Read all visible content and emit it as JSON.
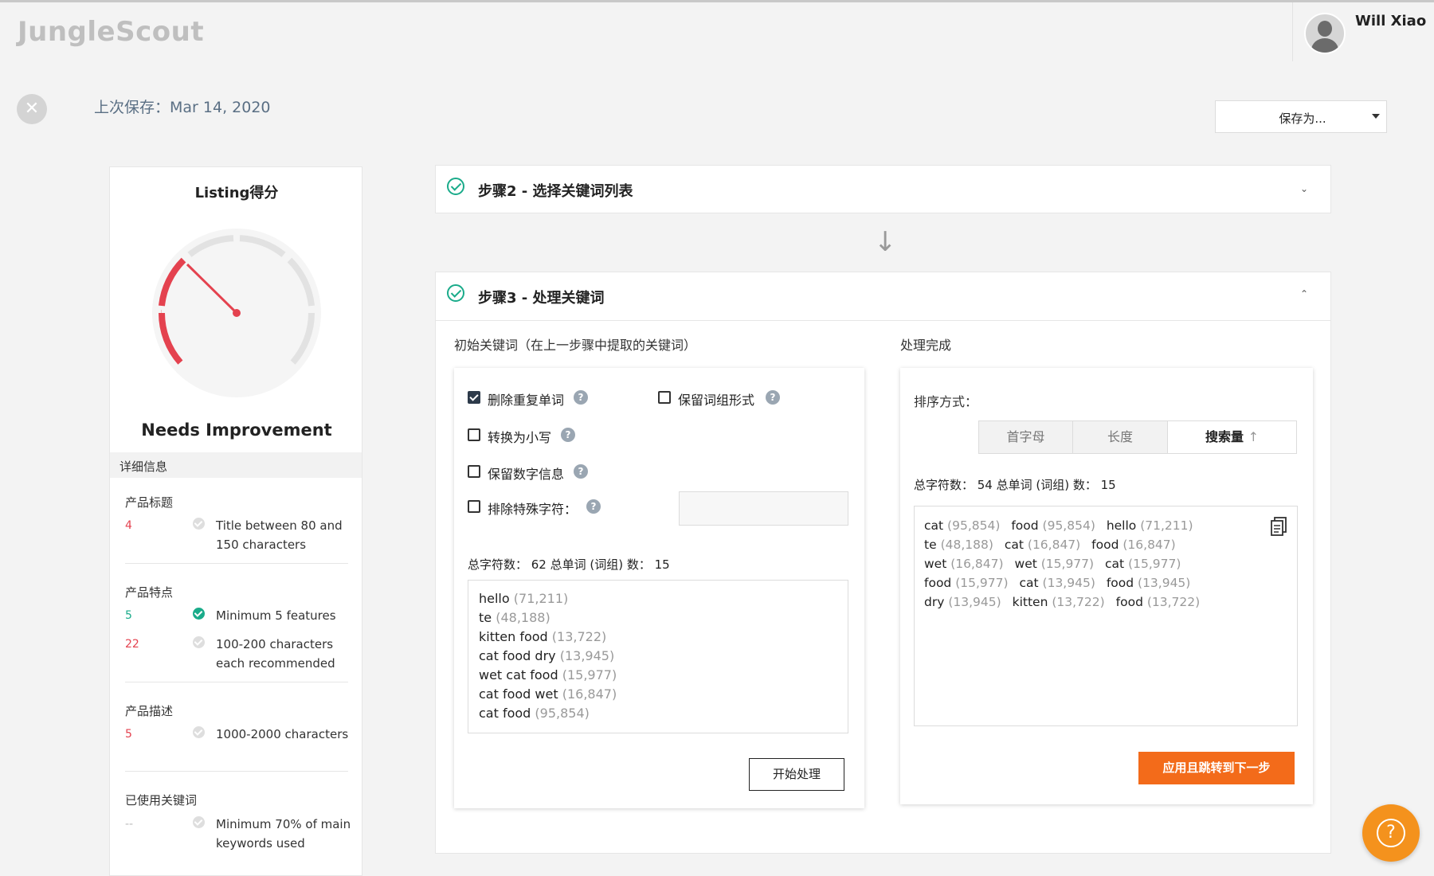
{
  "brand": {
    "logo": "JungleScout"
  },
  "user": {
    "name": "Will Xiao"
  },
  "header": {
    "last_saved": "上次保存：Mar 14, 2020",
    "save_as_label": "保存为..."
  },
  "score_panel": {
    "title": "Listing得分",
    "status": "Needs Improvement",
    "details_label": "详细信息",
    "sections": {
      "title": {
        "label": "产品标题",
        "value": "4",
        "req": "Title between 80 and 150 characters"
      },
      "features": {
        "label": "产品特点",
        "value1": "5",
        "req1": "Minimum 5 features",
        "value2": "22",
        "req2": "100-200 characters each recommended"
      },
      "description": {
        "label": "产品描述",
        "value": "5",
        "req": "1000-2000 characters"
      },
      "keywords": {
        "label": "已使用关键词",
        "value": "--",
        "req": "Minimum 70% of main keywords used"
      }
    }
  },
  "step2": {
    "title": "步骤2 - 选择关键词列表"
  },
  "step3": {
    "title": "步骤3 - 处理关键词",
    "left_title": "初始关键词（在上一步骤中提取的关键词）",
    "right_title": "处理完成",
    "options": {
      "remove_dupes": "删除重复单词",
      "keep_phrase": "保留词组形式",
      "lowercase": "转换为小写",
      "keep_numbers": "保留数字信息",
      "exclude_special": "排除特殊字符："
    },
    "left_stats": "总字符数： 62 总单词 (词组) 数： 15",
    "initial_keywords": [
      {
        "kw": "hello",
        "count": "(71,211)"
      },
      {
        "kw": "te",
        "count": "(48,188)"
      },
      {
        "kw": "kitten food",
        "count": "(13,722)"
      },
      {
        "kw": "cat food dry",
        "count": "(13,945)"
      },
      {
        "kw": "wet cat food",
        "count": "(15,977)"
      },
      {
        "kw": "cat food wet",
        "count": "(16,847)"
      },
      {
        "kw": "cat food",
        "count": "(95,854)"
      }
    ],
    "start_button": "开始处理",
    "sort_label": "排序方式：",
    "sort": {
      "alpha": "首字母",
      "length": "长度",
      "volume": "搜索量",
      "volume_arrow": "↑"
    },
    "right_stats": "总字符数： 54 总单词 (词组) 数： 15",
    "processed_keywords": [
      {
        "kw": "cat",
        "count": "(95,854)"
      },
      {
        "kw": "food",
        "count": "(95,854)"
      },
      {
        "kw": "hello",
        "count": "(71,211)"
      },
      {
        "kw": "te",
        "count": "(48,188)"
      },
      {
        "kw": "cat",
        "count": "(16,847)"
      },
      {
        "kw": "food",
        "count": "(16,847)"
      },
      {
        "kw": "wet",
        "count": "(16,847)"
      },
      {
        "kw": "wet",
        "count": "(15,977)"
      },
      {
        "kw": "cat",
        "count": "(15,977)"
      },
      {
        "kw": "food",
        "count": "(15,977)"
      },
      {
        "kw": "cat",
        "count": "(13,945)"
      },
      {
        "kw": "food",
        "count": "(13,945)"
      },
      {
        "kw": "dry",
        "count": "(13,945)"
      },
      {
        "kw": "kitten",
        "count": "(13,722)"
      },
      {
        "kw": "food",
        "count": "(13,722)"
      }
    ],
    "apply_button": "应用且跳转到下一步"
  },
  "colors": {
    "accent": "#f36b1a",
    "success": "#1aab8a",
    "danger": "#e4424f",
    "fab": "#f4921d"
  },
  "icons": {
    "close": "close-icon",
    "copy": "copy-icon",
    "help": "help-icon",
    "check": "check-circle-icon"
  }
}
